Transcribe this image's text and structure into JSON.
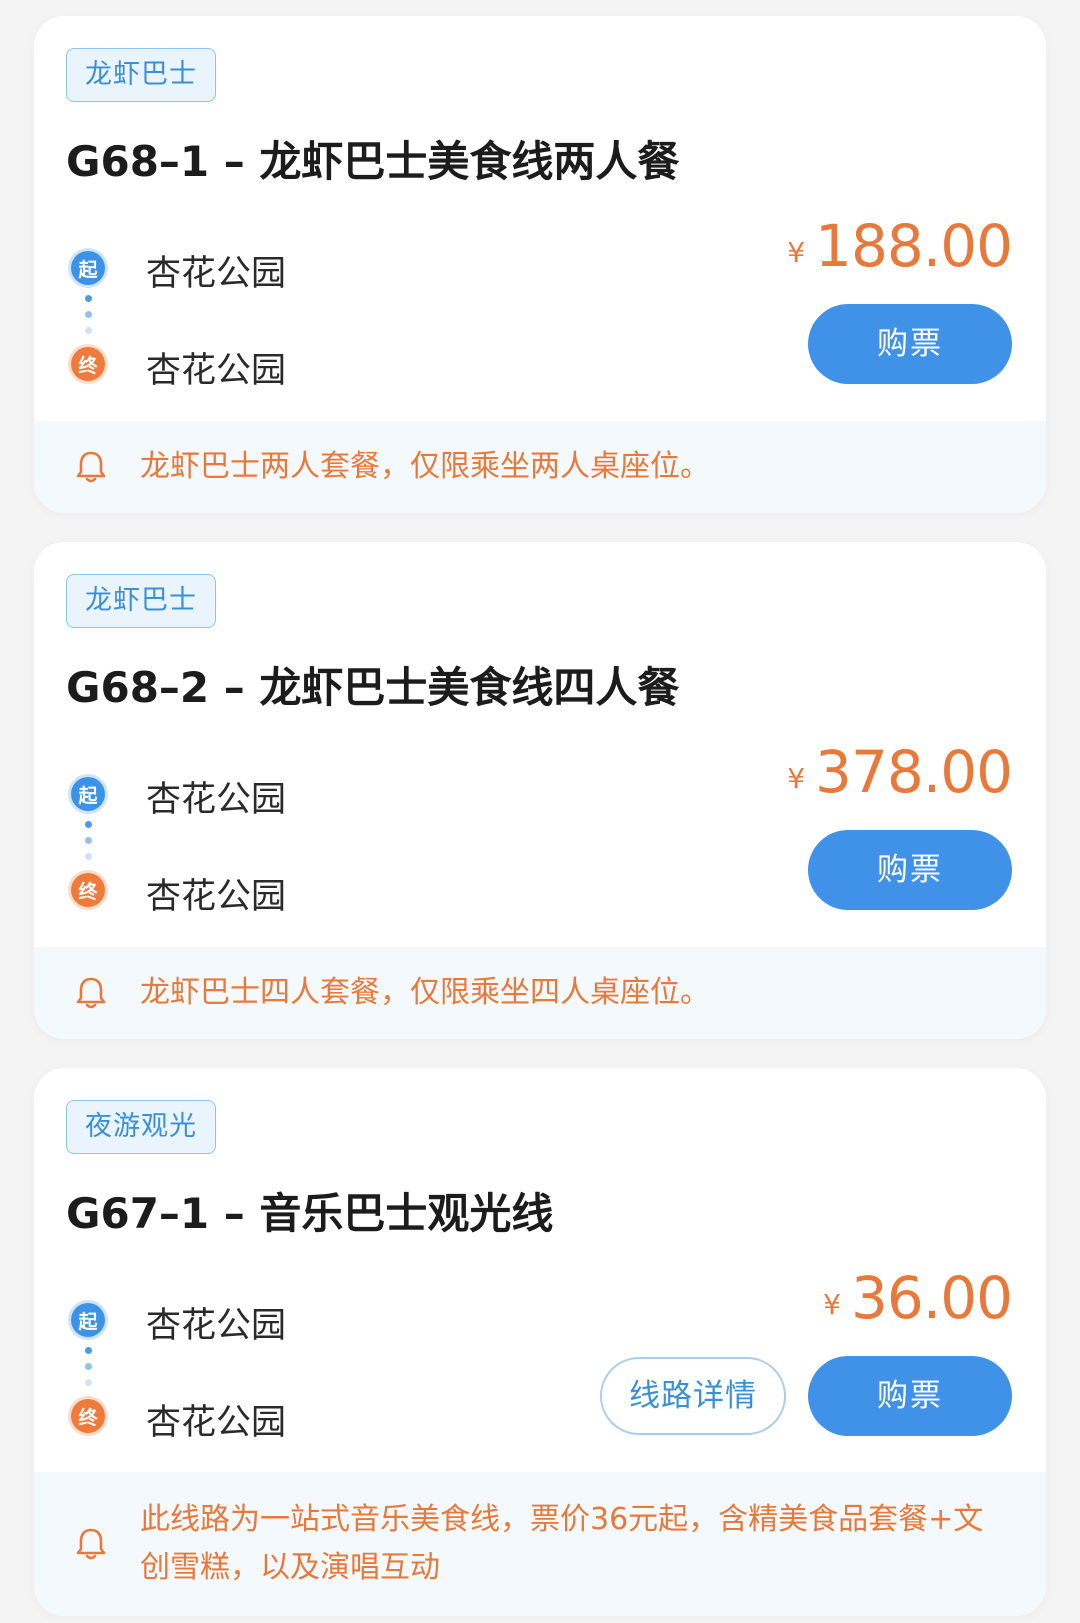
{
  "routes": [
    {
      "tag": "龙虾巴士",
      "title": "G68–1 – 龙虾巴士美食线两人餐",
      "start_label": "起",
      "start_stop": "杏花公园",
      "end_label": "终",
      "end_stop": "杏花公园",
      "currency": "¥",
      "price": "188.00",
      "buy_label": "购票",
      "notice": "龙虾巴士两人套餐，仅限乘坐两人桌座位。"
    },
    {
      "tag": "龙虾巴士",
      "title": "G68–2 – 龙虾巴士美食线四人餐",
      "start_label": "起",
      "start_stop": "杏花公园",
      "end_label": "终",
      "end_stop": "杏花公园",
      "currency": "¥",
      "price": "378.00",
      "buy_label": "购票",
      "notice": "龙虾巴士四人套餐，仅限乘坐四人桌座位。"
    },
    {
      "tag": "夜游观光",
      "title": "G67–1 – 音乐巴士观光线",
      "start_label": "起",
      "start_stop": "杏花公园",
      "end_label": "终",
      "end_stop": "杏花公园",
      "currency": "¥",
      "price": "36.00",
      "detail_label": "线路详情",
      "buy_label": "购票",
      "notice": "此线路为一站式音乐美食线，票价36元起，含精美食品套餐+文创雪糕，以及演唱互动"
    }
  ],
  "colors": {
    "accent_blue": "#3f92e8",
    "price_orange": "#e9793a",
    "page_bg": "#f4f4f5"
  }
}
